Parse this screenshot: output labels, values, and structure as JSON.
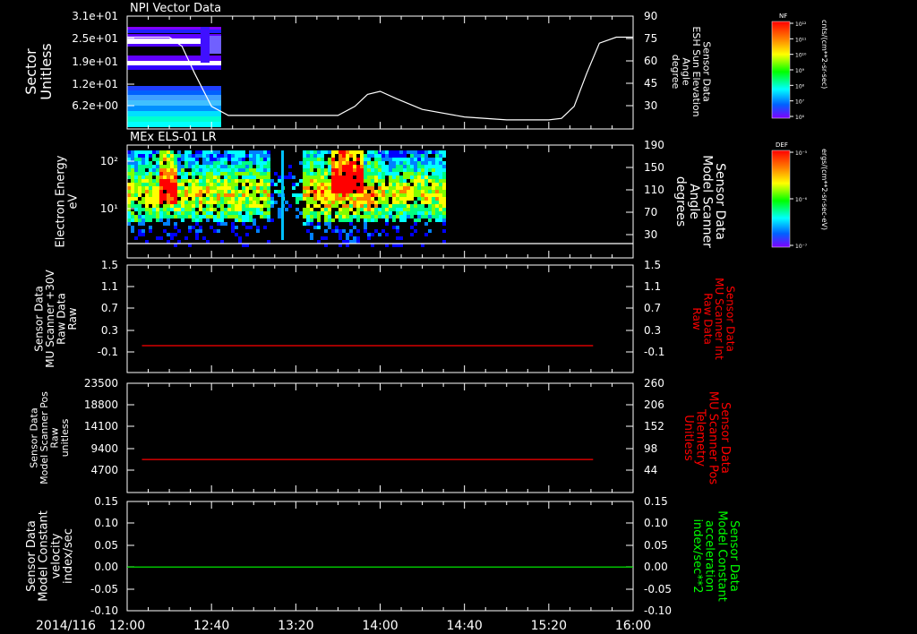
{
  "date_label": "2014/116",
  "x_ticks": [
    "12:00",
    "12:40",
    "13:20",
    "14:00",
    "14:40",
    "15:20",
    "16:00"
  ],
  "panel1_title": "NPI Vector Data",
  "panel2_title": "MEx ELS-01 LR",
  "colorbar_npi": {
    "label": "NF",
    "unit": "cnts/(cm**2-sr-sec)",
    "ticks": [
      "10¹²",
      "10¹¹",
      "10¹⁰",
      "10⁹",
      "10⁸",
      "10⁷",
      "10⁶"
    ]
  },
  "colorbar_els": {
    "label": "DEF",
    "unit": "ergs/(cm**2-sr-sec-eV)",
    "ticks": [
      "10⁻⁵",
      "10⁻⁶",
      "10⁻⁷"
    ]
  },
  "chart_data": [
    {
      "type": "heatmap",
      "title": "NPI Vector Data",
      "ylabel": [
        "Sector",
        "Unitless"
      ],
      "y_ticks": [
        "3.1e+01",
        "2.5e+01",
        "1.9e+01",
        "1.2e+01",
        "6.2e+00"
      ],
      "overlay": {
        "type": "line",
        "ylabel": [
          "Sensor Data",
          "ESH Sun Elevation",
          "Angle",
          "degree"
        ],
        "y_ticks": [
          "90",
          "75",
          "60",
          "45",
          "30"
        ],
        "ylim": [
          15,
          90
        ],
        "color": "#ffffff",
        "x": [
          "12:00",
          "12:12",
          "12:20",
          "12:26",
          "12:32",
          "12:40",
          "12:48",
          "13:00",
          "13:20",
          "13:30",
          "13:40",
          "13:48",
          "13:54",
          "14:00",
          "14:08",
          "14:20",
          "14:40",
          "15:00",
          "15:10",
          "15:20",
          "15:26",
          "15:32",
          "15:38",
          "15:44",
          "15:52",
          "16:00"
        ],
        "values": [
          76,
          76,
          76,
          70,
          52,
          30,
          24,
          24,
          24,
          24,
          24,
          30,
          38,
          40,
          35,
          28,
          23,
          21,
          21,
          21,
          22,
          30,
          52,
          72,
          76,
          76
        ]
      }
    },
    {
      "type": "heatmap",
      "title": "MEx ELS-01 LR",
      "ylabel": [
        "Electron Energy",
        "eV"
      ],
      "y_ticks": [
        "10²",
        "10¹"
      ],
      "right_ylabel": [
        "Sensor Data",
        "Model Scanner",
        "Angle",
        "degrees"
      ],
      "right_y_ticks": [
        "190",
        "150",
        "110",
        "70",
        "30"
      ]
    },
    {
      "type": "line",
      "ylabel": [
        "Sensor Data",
        "MU Scanner +30V",
        "Raw Data",
        "Raw"
      ],
      "y_ticks": [
        "1.5",
        "1.1",
        "0.7",
        "0.3",
        "-0.1"
      ],
      "ylim": [
        -0.5,
        1.5
      ],
      "right_ylabel": [
        "Sensor Data",
        "MU Scanner Int",
        "Raw Data",
        "Raw"
      ],
      "right_y_ticks": [
        "1.5",
        "1.1",
        "0.7",
        "0.3",
        "-0.1"
      ],
      "series": [
        {
          "color": "#ff0000",
          "x": [
            "12:07",
            "15:41"
          ],
          "values": [
            0.0,
            0.0
          ]
        }
      ]
    },
    {
      "type": "line",
      "ylabel": [
        "Sensor Data",
        "Model Scanner Pos",
        "Raw",
        "unitless"
      ],
      "y_ticks": [
        "23500",
        "18800",
        "14100",
        "9400",
        "4700"
      ],
      "ylim": [
        0,
        23500
      ],
      "right_ylabel": [
        "Sensor Data",
        "MU Scanner Pos",
        "Telemetry",
        "Unitless"
      ],
      "right_y_ticks": [
        "260",
        "206",
        "152",
        "98",
        "44"
      ],
      "series": [
        {
          "color": "#ff0000",
          "x": [
            "12:07",
            "15:41"
          ],
          "values": [
            7100,
            7100
          ]
        }
      ]
    },
    {
      "type": "line",
      "ylabel": [
        "Sensor Data",
        "Model Constant",
        "velocity",
        "index/sec"
      ],
      "y_ticks": [
        "0.15",
        "0.10",
        "0.05",
        "0.00",
        "-0.05",
        "-0.10"
      ],
      "ylim": [
        -0.1,
        0.15
      ],
      "right_ylabel": [
        "Sensor Data",
        "Model Constant",
        "acceleration",
        "index/sec**2"
      ],
      "right_y_ticks": [
        "0.15",
        "0.10",
        "0.05",
        "0.00",
        "-0.05",
        "-0.10"
      ],
      "series": [
        {
          "color": "#00ff00",
          "x": [
            "12:00",
            "16:00"
          ],
          "values": [
            0.0,
            0.0
          ]
        }
      ]
    }
  ],
  "colors": {
    "white_axis": "#ffffff",
    "red_label": "#ff0000",
    "green_label": "#00ff00"
  }
}
